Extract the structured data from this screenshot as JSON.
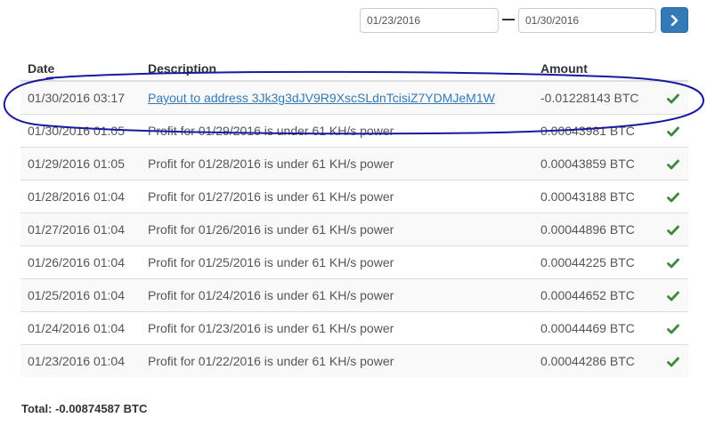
{
  "filter": {
    "date_from": "01/23/2016",
    "date_to": "01/30/2016",
    "submit_icon": "chevron-right-icon"
  },
  "table": {
    "headers": {
      "date": "Date",
      "description": "Description",
      "amount": "Amount"
    },
    "rows": [
      {
        "date": "01/30/2016 03:17",
        "description": "Payout to address 3Jk3g3dJV9R9XscSLdnTcisiZ7YDMJeM1W",
        "amount": "-0.01228143 BTC",
        "link": true
      },
      {
        "date": "01/30/2016 01:05",
        "description": "Profit for 01/29/2016 is under 61 KH/s power",
        "amount": "0.00043981 BTC",
        "link": false
      },
      {
        "date": "01/29/2016 01:05",
        "description": "Profit for 01/28/2016 is under 61 KH/s power",
        "amount": "0.00043859 BTC",
        "link": false
      },
      {
        "date": "01/28/2016 01:04",
        "description": "Profit for 01/27/2016 is under 61 KH/s power",
        "amount": "0.00043188 BTC",
        "link": false
      },
      {
        "date": "01/27/2016 01:04",
        "description": "Profit for 01/26/2016 is under 61 KH/s power",
        "amount": "0.00044896 BTC",
        "link": false
      },
      {
        "date": "01/26/2016 01:04",
        "description": "Profit for 01/25/2016 is under 61 KH/s power",
        "amount": "0.00044225 BTC",
        "link": false
      },
      {
        "date": "01/25/2016 01:04",
        "description": "Profit for 01/24/2016 is under 61 KH/s power",
        "amount": "0.00044652 BTC",
        "link": false
      },
      {
        "date": "01/24/2016 01:04",
        "description": "Profit for 01/23/2016 is under 61 KH/s power",
        "amount": "0.00044469 BTC",
        "link": false
      },
      {
        "date": "01/23/2016 01:04",
        "description": "Profit for 01/22/2016 is under 61 KH/s power",
        "amount": "0.00044286 BTC",
        "link": false
      }
    ],
    "status_icon": "checkmark-icon"
  },
  "total": "Total: -0.00874587 BTC",
  "colors": {
    "link": "#337ab7",
    "button": "#337ab7",
    "check": "#3c8a3c",
    "annotation": "#1a1aa0"
  }
}
